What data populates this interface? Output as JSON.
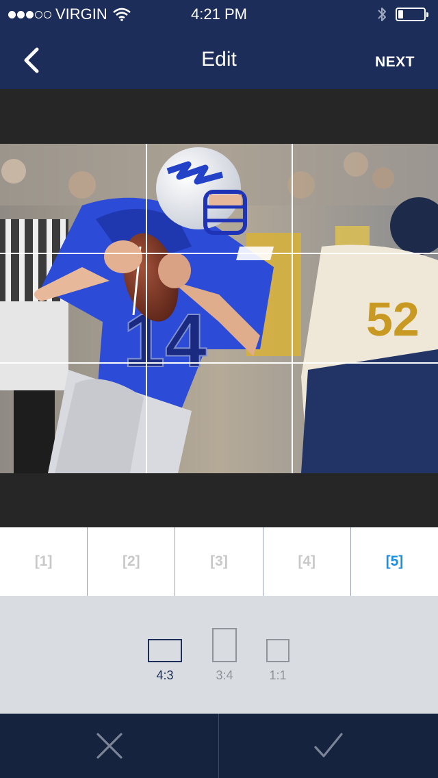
{
  "status_bar": {
    "carrier": "VIRGIN",
    "time": "4:21 PM",
    "signal_bars": 3,
    "signal_max": 5,
    "battery_level": 0.2
  },
  "nav": {
    "title": "Edit",
    "next_label": "NEXT",
    "back_icon": "chevron-left-icon"
  },
  "photo": {
    "subject": "football-photo",
    "grid": "3x3"
  },
  "tabs": [
    {
      "label": "[1]",
      "active": false
    },
    {
      "label": "[2]",
      "active": false
    },
    {
      "label": "[3]",
      "active": false
    },
    {
      "label": "[4]",
      "active": false
    },
    {
      "label": "[5]",
      "active": true
    }
  ],
  "aspect_ratios": [
    {
      "label": "4:3",
      "selected": true
    },
    {
      "label": "3:4",
      "selected": false
    },
    {
      "label": "1:1",
      "selected": false
    }
  ],
  "footer": {
    "cancel_icon": "close-icon",
    "confirm_icon": "checkmark-icon"
  },
  "colors": {
    "header": "#1b2d58",
    "footer": "#16233f",
    "active_tab": "#1a8fe0",
    "inactive_tab": "#c8c8c8",
    "ratio_bar": "#d9dce1"
  }
}
